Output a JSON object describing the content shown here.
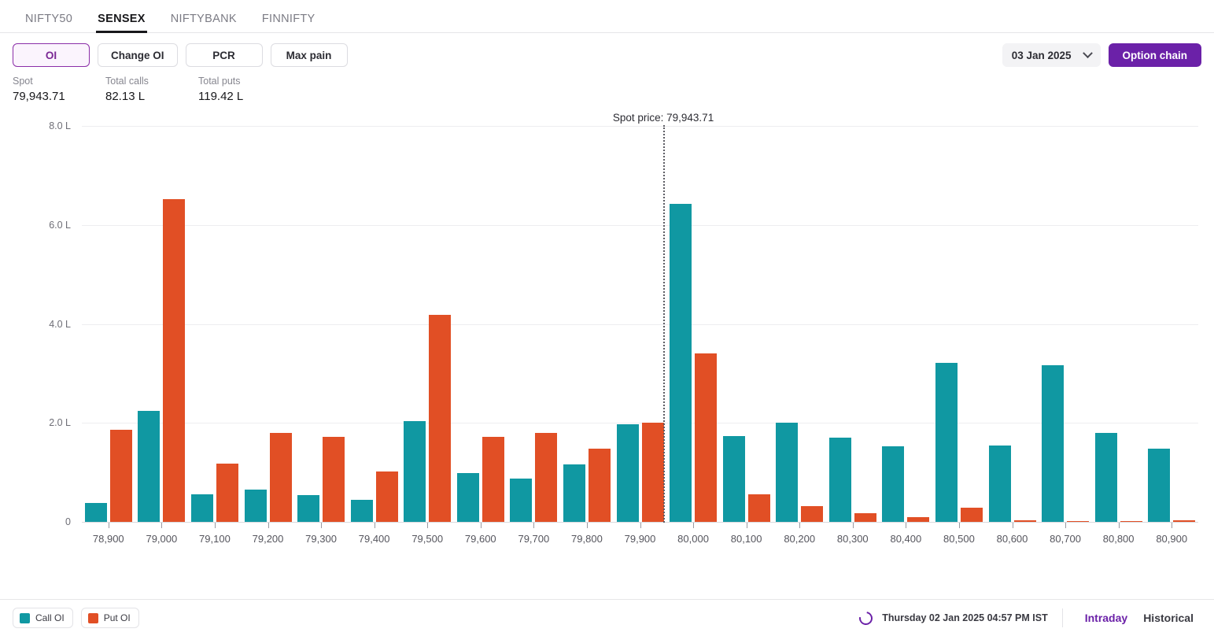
{
  "index_tabs": [
    {
      "label": "NIFTY50",
      "active": false
    },
    {
      "label": "SENSEX",
      "active": true
    },
    {
      "label": "NIFTYBANK",
      "active": false
    },
    {
      "label": "FINNIFTY",
      "active": false
    }
  ],
  "metric_buttons": [
    {
      "label": "OI",
      "active": true
    },
    {
      "label": "Change OI",
      "active": false
    },
    {
      "label": "PCR",
      "active": false
    },
    {
      "label": "Max pain",
      "active": false
    }
  ],
  "date_selector": {
    "value": "03 Jan 2025",
    "icon": "chevron-down-icon"
  },
  "option_chain_button": {
    "label": "Option chain"
  },
  "stats": [
    {
      "label": "Spot",
      "value": "79,943.71"
    },
    {
      "label": "Total calls",
      "value": "82.13 L"
    },
    {
      "label": "Total puts",
      "value": "119.42 L"
    }
  ],
  "spot_annotation": {
    "label": "Spot price: 79,943.71",
    "value": 79943.71
  },
  "legend": [
    {
      "label": "Call OI",
      "color": "#1098a2",
      "icon": "call-oi-swatch"
    },
    {
      "label": "Put OI",
      "color": "#e14f25",
      "icon": "put-oi-swatch"
    }
  ],
  "footer": {
    "refresh_icon": "refresh-icon",
    "timestamp": "Thursday 02 Jan 2025 04:57 PM IST",
    "modes": [
      {
        "label": "Intraday",
        "active": true
      },
      {
        "label": "Historical",
        "active": false
      }
    ]
  },
  "chart_data": {
    "type": "bar",
    "title": "",
    "xlabel": "",
    "ylabel": "",
    "ylim": [
      0,
      8.0
    ],
    "yticks": [
      0,
      2.0,
      4.0,
      6.0,
      8.0
    ],
    "ytick_labels": [
      "0",
      "2.0 L",
      "4.0 L",
      "6.0 L",
      "8.0 L"
    ],
    "unit": "L",
    "grid": true,
    "legend_position": "bottom-left",
    "categories": [
      "78,900",
      "79,000",
      "79,100",
      "79,200",
      "79,300",
      "79,400",
      "79,500",
      "79,600",
      "79,700",
      "79,800",
      "79,900",
      "80,000",
      "80,100",
      "80,200",
      "80,300",
      "80,400",
      "80,500",
      "80,600",
      "80,700",
      "80,800",
      "80,900"
    ],
    "series": [
      {
        "name": "Call OI",
        "color": "#1098a2",
        "values": [
          0.38,
          2.24,
          0.55,
          0.65,
          0.54,
          0.44,
          2.04,
          0.98,
          0.88,
          1.16,
          1.98,
          6.42,
          1.73,
          2.0,
          1.7,
          1.52,
          3.22,
          1.55,
          3.16,
          1.8,
          1.48
        ]
      },
      {
        "name": "Put OI",
        "color": "#e14f25",
        "values": [
          1.86,
          6.52,
          1.18,
          1.8,
          1.72,
          1.02,
          4.18,
          1.72,
          1.8,
          1.48,
          2.0,
          3.4,
          0.55,
          0.32,
          0.18,
          0.09,
          0.28,
          0.03,
          0.02,
          0.02,
          0.04
        ]
      }
    ],
    "annotations": [
      {
        "type": "vline",
        "label": "Spot price: 79,943.71",
        "x": 79943.71,
        "style": "dotted"
      }
    ]
  }
}
